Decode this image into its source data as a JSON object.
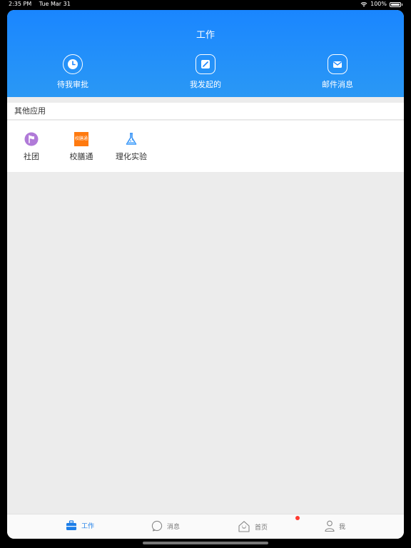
{
  "status_bar": {
    "time": "2:35 PM",
    "date": "Tue Mar 31",
    "battery": "100%"
  },
  "header": {
    "title": "工作",
    "actions": [
      {
        "label": "待我审批",
        "icon": "clock-icon"
      },
      {
        "label": "我发起的",
        "icon": "edit-icon"
      },
      {
        "label": "邮件消息",
        "icon": "mail-icon"
      }
    ]
  },
  "other_apps": {
    "title": "其他应用",
    "items": [
      {
        "label": "社团",
        "icon": "club-flag-icon",
        "color": "#b07ad8"
      },
      {
        "label": "校膳通",
        "icon": "canteen-logo-icon",
        "color": "#ff7a0f",
        "logo_text": "校膳通"
      },
      {
        "label": "理化实验",
        "icon": "flask-icon",
        "color": "#2f8ff5"
      }
    ]
  },
  "tabbar": {
    "items": [
      {
        "label": "工作",
        "icon": "briefcase-icon",
        "active": true
      },
      {
        "label": "消息",
        "icon": "chat-bubble-icon",
        "active": false
      },
      {
        "label": "首页",
        "icon": "home-icon",
        "active": false
      },
      {
        "label": "我",
        "icon": "person-icon",
        "active": false
      }
    ],
    "accent": "#1d7ee8",
    "badge_color": "#ff3b30"
  }
}
